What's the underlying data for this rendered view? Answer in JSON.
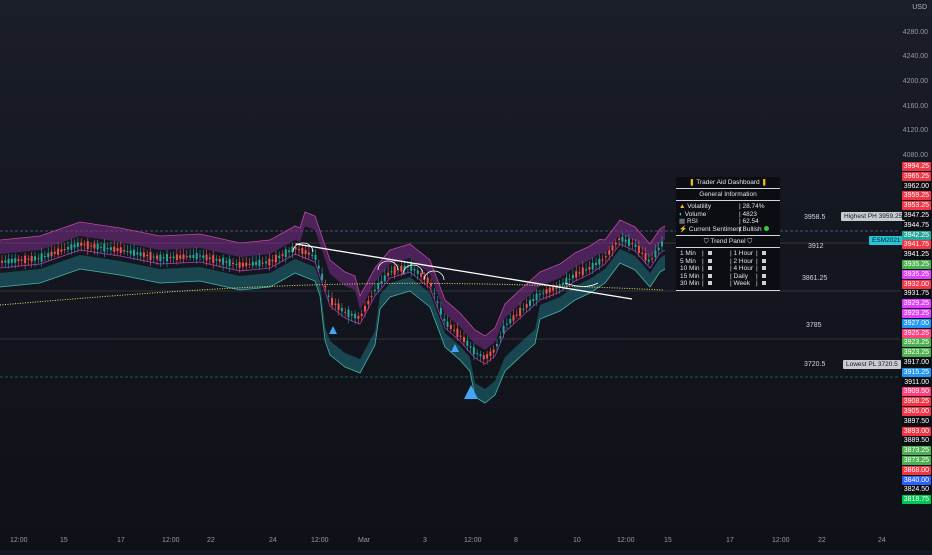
{
  "currency": "USD",
  "price_axis": [
    "4280.00",
    "4240.00",
    "4200.00",
    "4160.00",
    "4120.00",
    "4080.00"
  ],
  "x_axis": [
    "12:00",
    "15",
    "17",
    "12:00",
    "22",
    "24",
    "12:00",
    "Mar",
    "3",
    "12:00",
    "8",
    "10",
    "12:00",
    "15",
    "17",
    "12:00",
    "22",
    "24"
  ],
  "level_labels": [
    {
      "text": "3958.5",
      "price": 3958.5
    },
    {
      "text": "3912",
      "price": 3912
    },
    {
      "text": "3861.25",
      "price": 3861.25
    },
    {
      "text": "3785",
      "price": 3785
    },
    {
      "text": "3720.5",
      "price": 3720.5
    }
  ],
  "callouts": {
    "highest": "Highest PH 3959.25",
    "lowest": "Lowest PL 3720.5",
    "symbol": "ESM2021"
  },
  "price_tags": [
    {
      "text": "3994.25",
      "color": "#f23645"
    },
    {
      "text": "3965.25",
      "color": "#f23645"
    },
    {
      "text": "3962.00",
      "color": "#0b0d12"
    },
    {
      "text": "3959.25",
      "color": "#f23645"
    },
    {
      "text": "3953.25",
      "color": "#f23645"
    },
    {
      "text": "3947.25",
      "color": "#0b0d12"
    },
    {
      "text": "3944.75",
      "color": "#0b0d12"
    },
    {
      "text": "3942.25",
      "color": "#26a69a"
    },
    {
      "text": "3941.75",
      "color": "#f23645"
    },
    {
      "text": "3941.25",
      "color": "#0b0d12"
    },
    {
      "text": "3935.25",
      "color": "#4caf50"
    },
    {
      "text": "3935.25",
      "color": "#e040fb"
    },
    {
      "text": "3932.00",
      "color": "#f23645"
    },
    {
      "text": "3931.75",
      "color": "#0b0d12"
    },
    {
      "text": "3929.25",
      "color": "#e040fb"
    },
    {
      "text": "3929.25",
      "color": "#e040fb"
    },
    {
      "text": "3927.00",
      "color": "#2196f3"
    },
    {
      "text": "3925.25",
      "color": "#ff4081"
    },
    {
      "text": "3923.25",
      "color": "#4caf50"
    },
    {
      "text": "3923.25",
      "color": "#4caf50"
    },
    {
      "text": "3917.00",
      "color": "#0b0d12"
    },
    {
      "text": "3915.25",
      "color": "#2196f3"
    },
    {
      "text": "3911.00",
      "color": "#0b0d12"
    },
    {
      "text": "3909.50",
      "color": "#ff4081"
    },
    {
      "text": "3908.25",
      "color": "#f23645"
    },
    {
      "text": "3905.00",
      "color": "#f23645"
    },
    {
      "text": "3897.50",
      "color": "#0b0d12"
    },
    {
      "text": "3893.00",
      "color": "#f23645"
    },
    {
      "text": "3889.50",
      "color": "#0b0d12"
    },
    {
      "text": "3873.25",
      "color": "#4caf50"
    },
    {
      "text": "3873.25",
      "color": "#4caf50"
    },
    {
      "text": "3868.00",
      "color": "#f23645"
    },
    {
      "text": "3840.00",
      "color": "#2962ff"
    },
    {
      "text": "3824.50",
      "color": "#0b0d12"
    },
    {
      "text": "3818.75",
      "color": "#00c853"
    }
  ],
  "dashboard": {
    "title": "Trader Aid Dashboard",
    "general_header": "General Information",
    "metrics": [
      {
        "label": "Volatility",
        "value": "| 28.74%"
      },
      {
        "label": "Volume",
        "value": "| 4823"
      },
      {
        "label": "RSI",
        "value": "| 62.54"
      },
      {
        "label": "Current Sentiment",
        "value": "| Bullish"
      }
    ],
    "trend_header": "Trend Panel",
    "trend_rows": [
      [
        "1 Min",
        "1 Hour"
      ],
      [
        "5 Min",
        "2 Hour"
      ],
      [
        "10 Min",
        "4 Hour"
      ],
      [
        "15 Min",
        "Daily"
      ],
      [
        "30 Min",
        "Week"
      ]
    ]
  }
}
